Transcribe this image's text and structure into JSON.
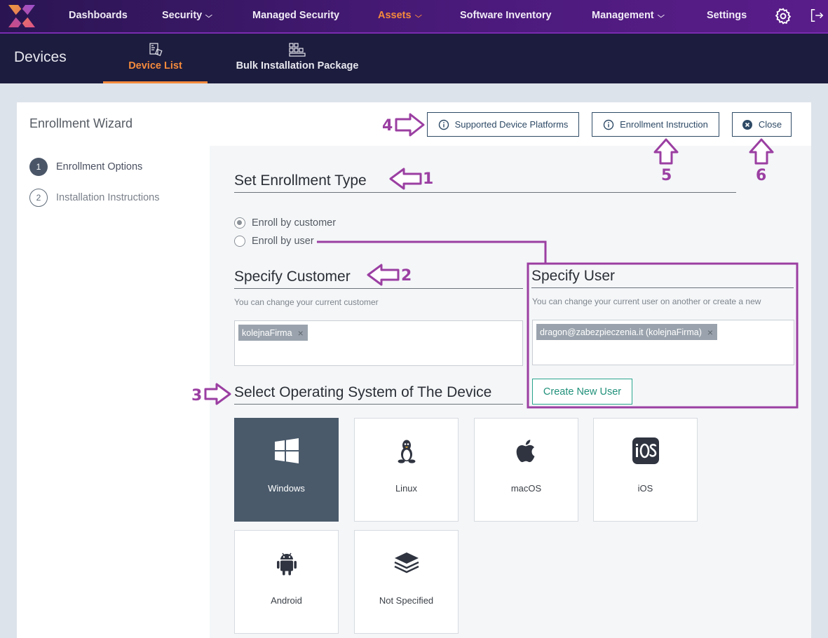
{
  "topnav": {
    "logo": "x-logo",
    "items": [
      {
        "label": "Dashboards",
        "dropdown": false,
        "active": false
      },
      {
        "label": "Security",
        "dropdown": true,
        "active": false
      },
      {
        "label": "Managed Security",
        "dropdown": false,
        "active": false
      },
      {
        "label": "Assets",
        "dropdown": true,
        "active": true
      },
      {
        "label": "Software Inventory",
        "dropdown": false,
        "active": false
      },
      {
        "label": "Management",
        "dropdown": true,
        "active": false
      },
      {
        "label": "Settings",
        "dropdown": false,
        "active": false
      }
    ],
    "icons": [
      "gear-icon",
      "logout-icon"
    ],
    "chevron": "⌵"
  },
  "subnav": {
    "title": "Devices",
    "tabs": [
      {
        "label": "Device List",
        "icon": "device-list-icon",
        "active": true
      },
      {
        "label": "Bulk Installation Package",
        "icon": "package-icon",
        "active": false
      }
    ]
  },
  "wizard": {
    "title": "Enrollment Wizard",
    "buttons": {
      "platforms": "Supported Device Platforms",
      "instruction": "Enrollment Instruction",
      "close": "Close"
    },
    "steps": [
      {
        "number": "1",
        "label": "Enrollment Options",
        "active": true
      },
      {
        "number": "2",
        "label": "Installation Instructions",
        "active": false
      }
    ]
  },
  "enrollment": {
    "title": "Set Enrollment Type",
    "options": [
      {
        "label": "Enroll by customer",
        "checked": true
      },
      {
        "label": "Enroll by user",
        "checked": false
      }
    ]
  },
  "customer": {
    "title": "Specify Customer",
    "helper": "You can change your current customer",
    "tag": "kolejnaFirma"
  },
  "user": {
    "title": "Specify User",
    "helper": "You can change your current user on another or create a new",
    "tag": "dragon@zabezpieczenia.it (kolejnaFirma)",
    "create_button": "Create New User"
  },
  "os": {
    "title": "Select Operating System of The Device",
    "selected": "Windows",
    "options": [
      {
        "label": "Windows",
        "icon": "windows-icon"
      },
      {
        "label": "Linux",
        "icon": "linux-icon"
      },
      {
        "label": "macOS",
        "icon": "apple-icon"
      },
      {
        "label": "iOS",
        "icon": "ios-icon"
      },
      {
        "label": "Android",
        "icon": "android-icon"
      },
      {
        "label": "Not Specified",
        "icon": "layers-icon"
      }
    ]
  },
  "tag_remove": "×",
  "annotations": {
    "color": "#9b3fa2",
    "labels": [
      "1",
      "2",
      "3",
      "4",
      "5",
      "6"
    ]
  }
}
